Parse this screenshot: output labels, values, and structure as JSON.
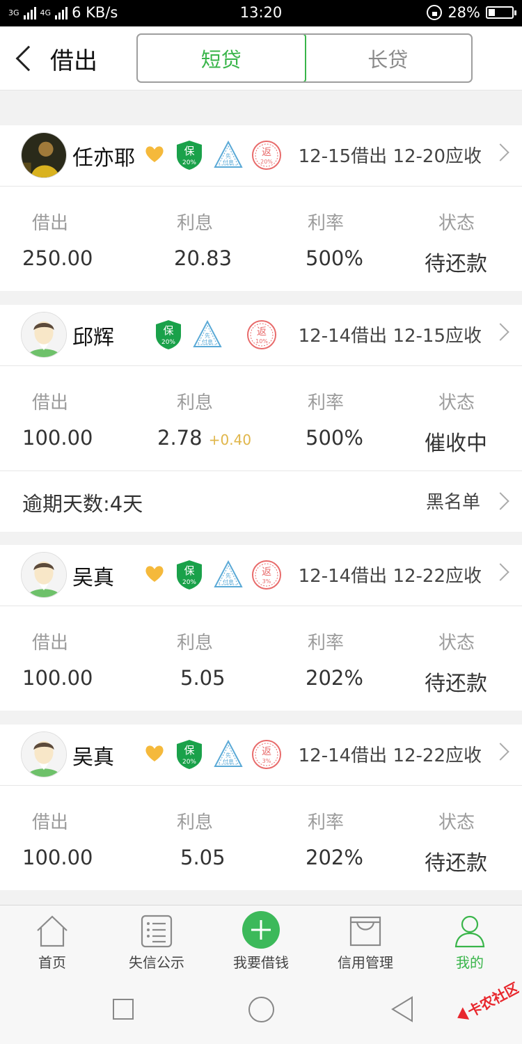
{
  "status_bar": {
    "net_left": "3G",
    "net_right": "4G",
    "speed": "6 KB/s",
    "time": "13:20",
    "battery": "28%",
    "battery_level": 0.28
  },
  "header": {
    "title": "借出",
    "tabs": [
      {
        "label": "短贷",
        "active": true
      },
      {
        "label": "长贷",
        "active": false
      }
    ]
  },
  "labels": {
    "lend": "借出",
    "interest": "利息",
    "rate": "利率",
    "status": "状态"
  },
  "badges": {
    "guarantee": "保",
    "prepay": "先付息",
    "rebate": "返"
  },
  "loans": [
    {
      "name": "任亦耶",
      "favorite": true,
      "guarantee_pct": "20%",
      "rebate_pct": "20%",
      "dates": "12-15借出 12-20应收",
      "amount": "250.00",
      "interest": "20.83",
      "interest_extra": "",
      "rate": "500%",
      "status": "待还款"
    },
    {
      "name": "邱辉",
      "favorite": false,
      "guarantee_pct": "20%",
      "rebate_pct": "10%",
      "dates": "12-14借出 12-15应收",
      "amount": "100.00",
      "interest": "2.78",
      "interest_extra": "+0.40",
      "rate": "500%",
      "status": "催收中",
      "overdue": "逾期天数:4天",
      "blacklist": "黑名单"
    },
    {
      "name": "吴真",
      "favorite": true,
      "guarantee_pct": "20%",
      "rebate_pct": "3%",
      "dates": "12-14借出 12-22应收",
      "amount": "100.00",
      "interest": "5.05",
      "interest_extra": "",
      "rate": "202%",
      "status": "待还款"
    },
    {
      "name": "吴真",
      "favorite": true,
      "guarantee_pct": "20%",
      "rebate_pct": "3%",
      "dates": "12-14借出 12-22应收",
      "amount": "100.00",
      "interest": "5.05",
      "interest_extra": "",
      "rate": "202%",
      "status": "待还款"
    }
  ],
  "tabbar": [
    {
      "label": "首页",
      "icon": "home-icon"
    },
    {
      "label": "失信公示",
      "icon": "list-icon"
    },
    {
      "label": "我要借钱",
      "icon": "plus-icon"
    },
    {
      "label": "信用管理",
      "icon": "tray-icon"
    },
    {
      "label": "我的",
      "icon": "person-icon",
      "active": true
    }
  ],
  "colors": {
    "accent": "#39b54a",
    "gold": "#f5b93b",
    "rebate_red": "#e86b6b",
    "prepay_blue": "#5aa9d6"
  }
}
